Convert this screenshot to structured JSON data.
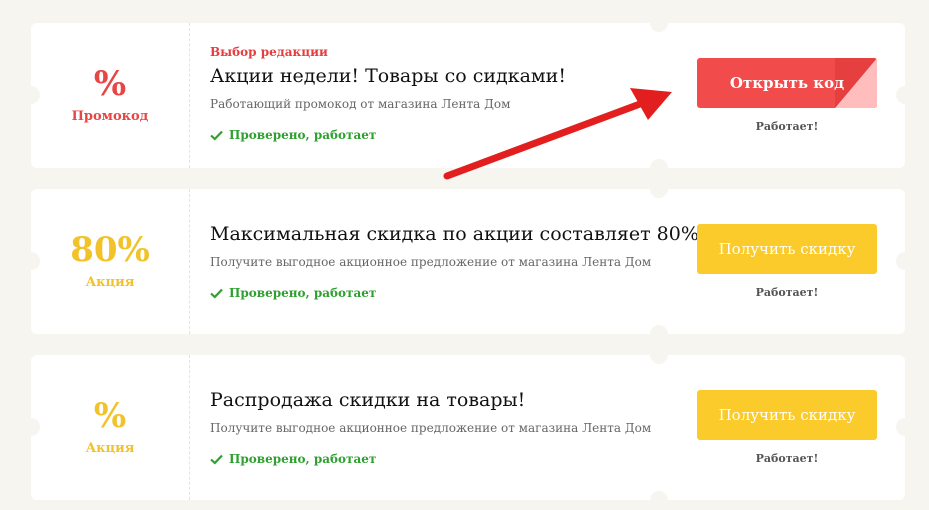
{
  "offers": [
    {
      "badge_value": "%",
      "badge_type": "Промокод",
      "badge_color": "#e84545",
      "editor_label": "Выбор редакции",
      "title": "Акции недели! Товары со сидками!",
      "subtitle": "Работающий промокод от магазина Лента Дом",
      "verified": "Проверено, работает",
      "button_label": "Открыть код",
      "button_style": "red",
      "status": "Работает!"
    },
    {
      "badge_value": "80%",
      "badge_type": "Акция",
      "badge_color": "#f2c22b",
      "title": "Максимальная скидка по акции составляет 80%",
      "subtitle": "Получите выгодное акционное предложение от магазина Лента Дом",
      "verified": "Проверено, работает",
      "button_label": "Получить скидку",
      "button_style": "yellow",
      "status": "Работает!"
    },
    {
      "badge_value": "%",
      "badge_type": "Акция",
      "badge_color": "#f2c22b",
      "title": "Распродажа скидки на товары!",
      "subtitle": "Получите выгодное акционное предложение от магазина Лента Дом",
      "verified": "Проверено, работает",
      "button_label": "Получить скидку",
      "button_style": "yellow",
      "status": "Работает!"
    }
  ],
  "colors": {
    "red": "#f24b4b",
    "yellow": "#fbcb2b",
    "green": "#2fa02f",
    "arrow": "#e31e1e"
  }
}
